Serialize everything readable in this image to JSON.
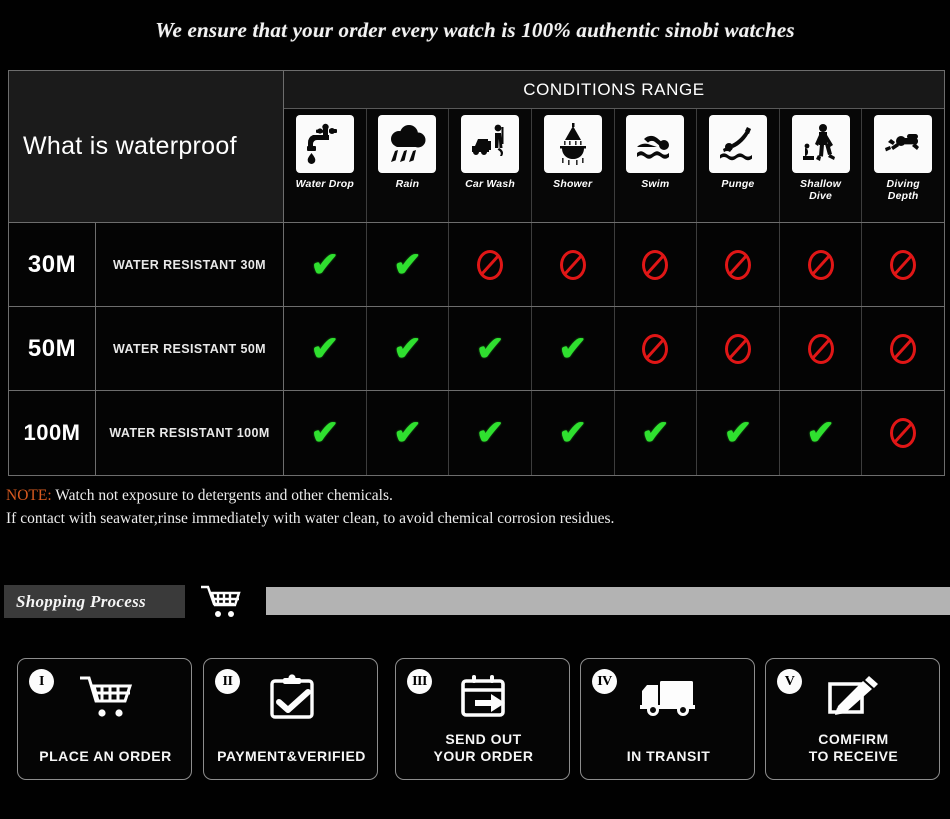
{
  "headline": "We ensure that your order every watch is 100% authentic sinobi watches",
  "table": {
    "title": "What is waterproof",
    "conditions_header": "CONDITIONS RANGE",
    "columns": [
      {
        "label": "Water Drop",
        "icon": "faucet-water-drop-icon"
      },
      {
        "label": "Rain",
        "icon": "rain-cloud-icon"
      },
      {
        "label": "Car Wash",
        "icon": "car-wash-icon"
      },
      {
        "label": "Shower",
        "icon": "shower-icon"
      },
      {
        "label": "Swim",
        "icon": "swimmer-icon"
      },
      {
        "label": "Punge",
        "icon": "plunge-dive-icon"
      },
      {
        "label": "Shallow\nDive",
        "icon": "shallow-dive-icon"
      },
      {
        "label": "Diving\nDepth",
        "icon": "scuba-diver-icon"
      }
    ],
    "rows": [
      {
        "depth": "30M",
        "description": "WATER RESISTANT  30M",
        "marks": [
          "yes",
          "yes",
          "no",
          "no",
          "no",
          "no",
          "no",
          "no"
        ]
      },
      {
        "depth": "50M",
        "description": "WATER RESISTANT 50M",
        "marks": [
          "yes",
          "yes",
          "yes",
          "yes",
          "no",
          "no",
          "no",
          "no"
        ]
      },
      {
        "depth": "100M",
        "description": "WATER RESISTANT  100M",
        "marks": [
          "yes",
          "yes",
          "yes",
          "yes",
          "yes",
          "yes",
          "yes",
          "no"
        ]
      }
    ],
    "mark_glyphs": {
      "yes": "✔",
      "no": ""
    }
  },
  "note": {
    "label": "NOTE:",
    "line1": " Watch not exposure to detergents and other chemicals.",
    "line2": "If contact with seawater,rinse immediately with water clean, to avoid chemical corrosion residues."
  },
  "shopping_process": {
    "label": "Shopping Process",
    "cart_icon": "shopping-cart-icon"
  },
  "steps": [
    {
      "num": "I",
      "label": "PLACE AN ORDER",
      "icon": "shopping-cart-icon"
    },
    {
      "num": "II",
      "label": "PAYMENT&VERIFIED",
      "icon": "clipboard-check-icon"
    },
    {
      "num": "III",
      "label": "SEND OUT\nYOUR ORDER",
      "icon": "calendar-arrow-icon"
    },
    {
      "num": "IV",
      "label": "IN TRANSIT",
      "icon": "delivery-truck-icon"
    },
    {
      "num": "V",
      "label": "COMFIRM\nTO RECEIVE",
      "icon": "sign-document-icon"
    }
  ],
  "colors": {
    "background": "#000000",
    "check_green": "#2fe02f",
    "prohibit_red": "#e01616",
    "note_orange": "#d85a20",
    "grid_line": "#6d6d6d",
    "track_gray": "#b3b3b3"
  }
}
